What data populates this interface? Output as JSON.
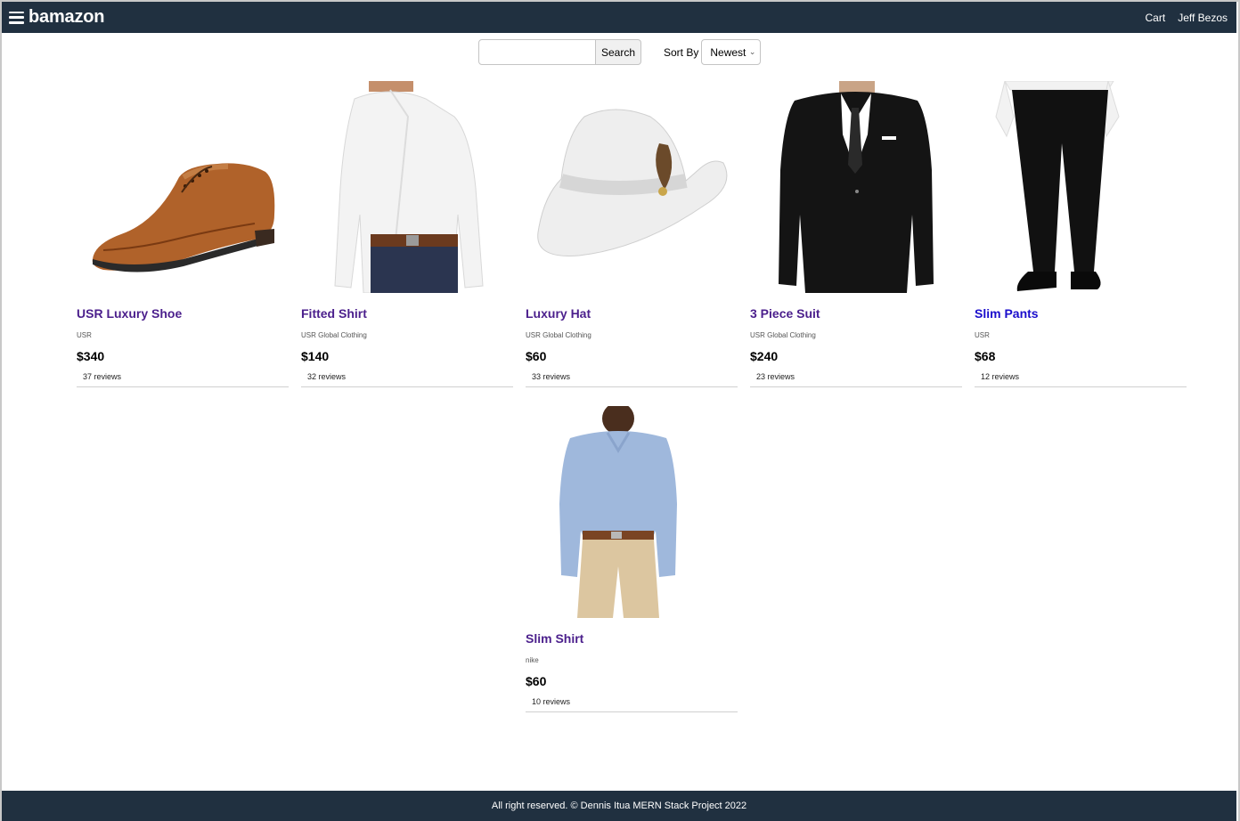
{
  "header": {
    "brand": "bamazon",
    "cart_label": "Cart",
    "user_name": "Jeff Bezos"
  },
  "search": {
    "value": "",
    "placeholder": "",
    "button_label": "Search"
  },
  "sort": {
    "label": "Sort By",
    "selected": "Newest"
  },
  "products": [
    {
      "name": "USR Luxury Shoe",
      "brand": "USR",
      "price": "$340",
      "reviews": "37 reviews",
      "image": "brown-leather-shoe"
    },
    {
      "name": "Fitted Shirt",
      "brand": "USR Global Clothing",
      "price": "$140",
      "reviews": "32 reviews",
      "image": "white-shirt-model"
    },
    {
      "name": "Luxury Hat",
      "brand": "USR Global Clothing",
      "price": "$60",
      "reviews": "33 reviews",
      "image": "white-fedora-hat"
    },
    {
      "name": "3 Piece Suit",
      "brand": "USR Global Clothing",
      "price": "$240",
      "reviews": "23 reviews",
      "image": "black-suit-model"
    },
    {
      "name": "Slim Pants",
      "brand": "USR",
      "price": "$68",
      "reviews": "12 reviews",
      "image": "black-pants-model"
    },
    {
      "name": "Slim Shirt",
      "brand": "nike",
      "price": "$60",
      "reviews": "10 reviews",
      "image": "blue-shirt-model"
    }
  ],
  "footer": {
    "text": "All right reserved. © Dennis Itua MERN Stack Project 2022"
  },
  "colors": {
    "navbar": "#203040",
    "link_visited": "#4b1f8c",
    "link_unvisited": "#1a0dcc"
  }
}
